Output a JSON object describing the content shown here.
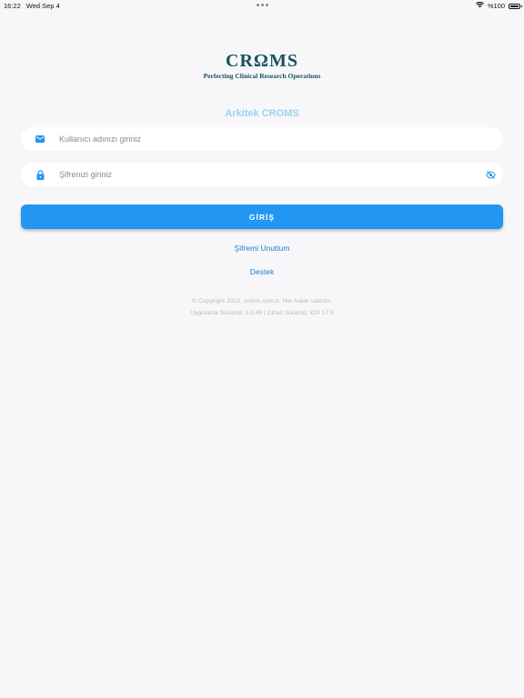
{
  "status_bar": {
    "time": "16:22",
    "date": "Wed Sep 4",
    "battery_text": "%100",
    "icons": [
      "wifi-icon",
      "battery-icon"
    ]
  },
  "logo": {
    "mark": "CRΩMS",
    "tagline": "Perfecting Clinical Research Operations",
    "color": "#17525f"
  },
  "app_title": "Arkitek CROMS",
  "form": {
    "username": {
      "placeholder": "Kullanıcı adınızı giriniz",
      "value": "",
      "icon": "envelope-icon"
    },
    "password": {
      "placeholder": "Şifrenizi giriniz",
      "value": "",
      "icon": "lock-icon",
      "toggle_icon": "eye-off-icon"
    },
    "submit_label": "GİRİŞ"
  },
  "links": {
    "forgot_password": "Şifremi Unuttum",
    "support": "Destek"
  },
  "footer": {
    "copyright": "© Copyright 2023, croms.com.tr. Her hakkı saklıdır.",
    "version": "Uygulama Sürümü: 1.0.49 | Cihaz Sürümü: iOS 17.5"
  },
  "colors": {
    "accent": "#2196f3",
    "link": "#1b7fd0",
    "title": "#9fd0ef",
    "background": "#f7f7f9"
  }
}
